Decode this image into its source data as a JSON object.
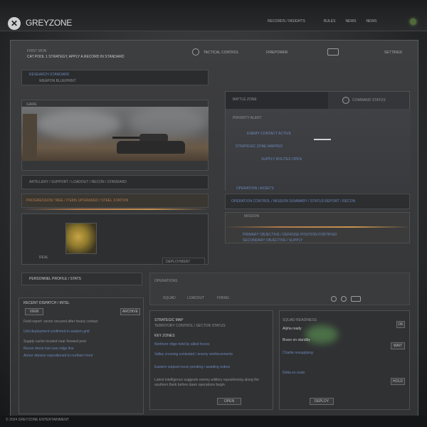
{
  "app": {
    "title": "GREYZONE"
  },
  "topnav": [
    "RECORDS / INSIGHTS",
    "RULES",
    "NEWS",
    "NEWS"
  ],
  "header_row": {
    "label": "FIRST MON",
    "subtitle": "CAT POOL 1 STRATEGY, APPLY A RECORD IN STANDARD",
    "item1": "TACTICAL CONTROL",
    "item2": "FIREPOWER",
    "item3": "SETTINGS"
  },
  "left_card": {
    "title_lines": [
      "RESEARCH STANDARD",
      "WEAPON BLUEPRINT"
    ],
    "hero_caption": "GAME",
    "caption_bar": "ARTILLERY / SUPPORT / LOADOUT / RECON / STANDARD",
    "bar2": "PROGRESSION TREE / ITEMS UPGRADED / STEEL STATION",
    "thumb_caption": "REAL",
    "thumb_bar": "DEPLOYMENT"
  },
  "right_card": {
    "header": "BATTLE ZONE",
    "header_right": "COMMAND STATUS",
    "lines": [
      "PRIORITY ALERT",
      "ENEMY CONTACT ACTIVE",
      "STRATEGIC ZONE MAPPED",
      "SUPPLY ROUTES OPEN"
    ],
    "footer_label": "OPERATION / ASSETS",
    "bar_text": "OPERATION CONTROL / MISSION SUMMARY / STATUS REPORT / RECON",
    "sub_label": "MISSION",
    "sub_lines": [
      "PRIMARY OBJECTIVE / DEFENSE POSITION FORTIFIED",
      "SECONDARY OBJECTIVE / SUPPLY"
    ]
  },
  "mid_row": {
    "left_title": "PERSONNEL PROFILE / STATS",
    "right_title": "OPERATIONS",
    "tabs": [
      "SQUAD",
      "LOADOUT",
      "FIRING"
    ]
  },
  "bottom_left": {
    "title": "RECENT DISPATCH / INTEL",
    "button": "VIEW",
    "badge": "ARCHIVE",
    "entries": [
      "Field report: sector secured after heavy contact",
      "Unit deployment confirmed in eastern grid",
      "Supply cache located near forward post",
      "Recon drone lost over ridge line",
      "Armor division repositioned to northern front"
    ]
  },
  "bottom_mid": {
    "title": "STRATEGIC MAP",
    "subtitle": "TERRITORY CONTROL / SECTOR STATUS",
    "section": "KEY ZONES",
    "lines": [
      "Northern ridge held by allied forces",
      "Valley crossing contested / enemy reinforcements",
      "Eastern outpost recon pending / awaiting orders"
    ],
    "note": "Latest intelligence suggests enemy artillery repositioning along the southern flank before dawn operations begin.",
    "button": "OPEN"
  },
  "bottom_right": {
    "title": "SQUAD READINESS",
    "items": [
      "Alpha ready",
      "Bravo on standby",
      "Charlie resupplying",
      "Delta en route"
    ],
    "badges": [
      "OK",
      "WAIT",
      "HOLD"
    ],
    "button": "DEPLOY"
  },
  "footer": "© 2024 GREYZONE ENTERTAINMENT",
  "colors": {
    "accent": "#b07a4a",
    "link": "#6a86b8",
    "status": "#6d8f4f"
  }
}
